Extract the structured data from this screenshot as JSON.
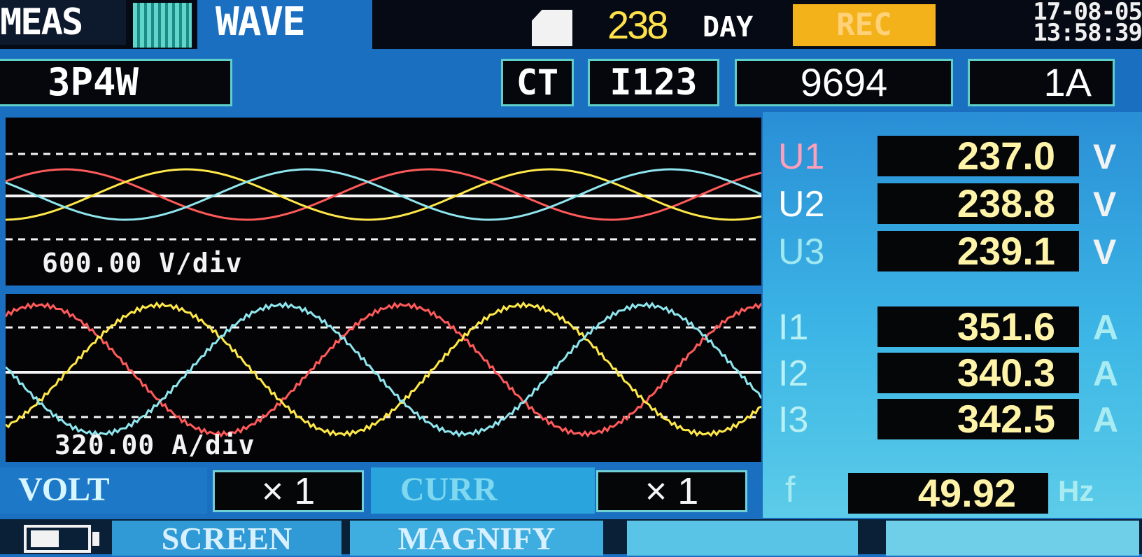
{
  "top": {
    "tab_meas": "MEAS",
    "tab_wave": "WAVE",
    "days_value": "238",
    "days_unit": "DAY",
    "rec": "REC",
    "date": "17-08-05",
    "time": "13:58:39"
  },
  "settings": {
    "wiring": "3P4W",
    "ct_label": "CT",
    "channels": "I123",
    "ratio": "9694",
    "range": "1A"
  },
  "scope": {
    "volt_div": "600.00 V/div",
    "curr_div": "320.00 A/div"
  },
  "readings": {
    "voltage": [
      {
        "label": "U1",
        "value": "237.0",
        "unit": "V"
      },
      {
        "label": "U2",
        "value": "238.8",
        "unit": "V"
      },
      {
        "label": "U3",
        "value": "239.1",
        "unit": "V"
      }
    ],
    "current": [
      {
        "label": "I1",
        "value": "351.6",
        "unit": "A"
      },
      {
        "label": "I2",
        "value": "340.3",
        "unit": "A"
      },
      {
        "label": "I3",
        "value": "342.5",
        "unit": "A"
      }
    ],
    "frequency": {
      "label": "f",
      "value": "49.92",
      "unit": "Hz"
    }
  },
  "zoom": {
    "volt_label": "VOLT",
    "volt_factor": "× 1",
    "curr_label": "CURR",
    "curr_factor": "× 1"
  },
  "function_keys": {
    "screen": "SCREEN",
    "magnify": "MAGNIFY",
    "key3": "",
    "key4": ""
  },
  "colors": {
    "phase1": "#ff5a5a",
    "phase2": "#ffe84a",
    "phase3": "#8fe6ee",
    "u1_label": "#ff9fb8",
    "u2_label": "#ffffff",
    "u3_label": "#9fe8f0",
    "i_label": "#b8f0f4"
  }
}
